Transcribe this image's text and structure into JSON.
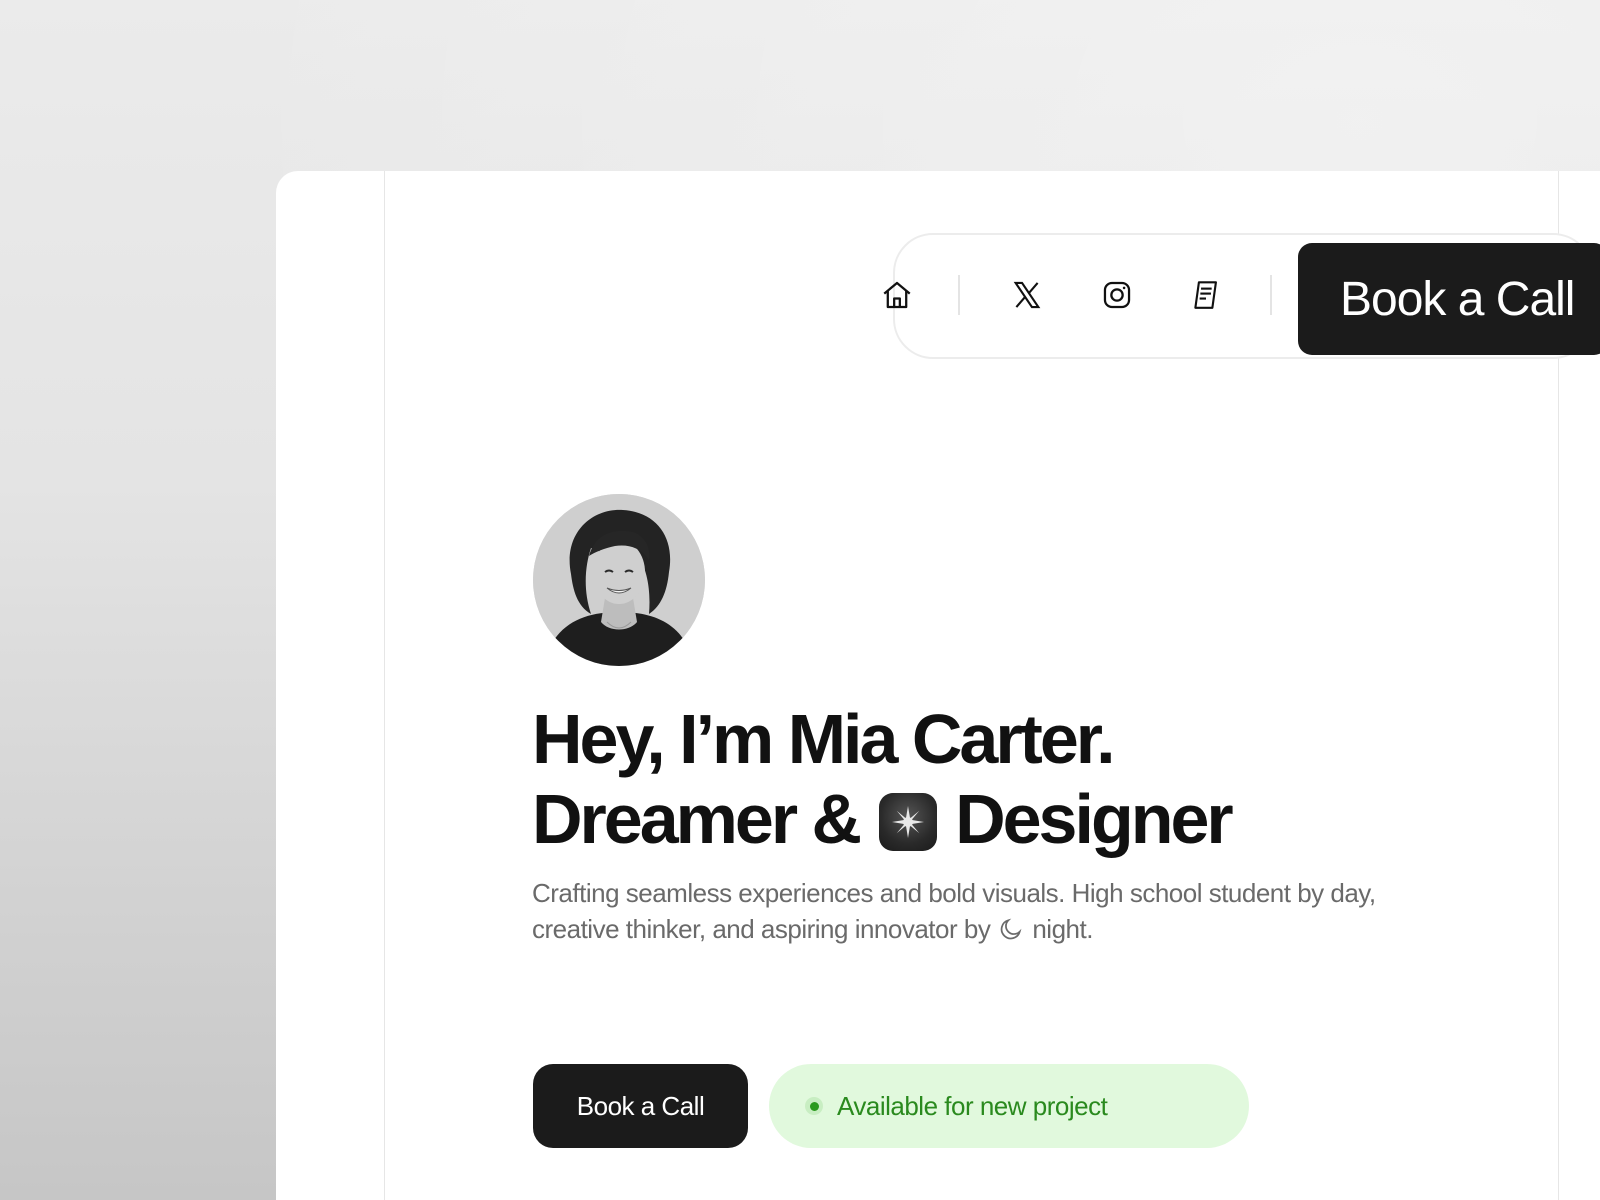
{
  "nav": {
    "icons": [
      "home-icon",
      "x-logo-icon",
      "instagram-icon",
      "notes-icon"
    ],
    "cta_label": "Book a Call"
  },
  "hero": {
    "avatar_alt": "Mia Carter portrait",
    "title_line1": "Hey, I’m Mia Carter.",
    "title_line2_pre": "Dreamer &",
    "title_line2_post": "Designer",
    "description_pre": "Crafting seamless experiences and bold visuals. High school student by day, creative thinker, and aspiring innovator by",
    "description_post": "night.",
    "primary_cta_label": "Book a Call",
    "status_label": "Available for new project"
  },
  "colors": {
    "cta_bg": "#1b1b1b",
    "status_bg": "#e1f9dd",
    "status_text": "#2a8a1e"
  }
}
